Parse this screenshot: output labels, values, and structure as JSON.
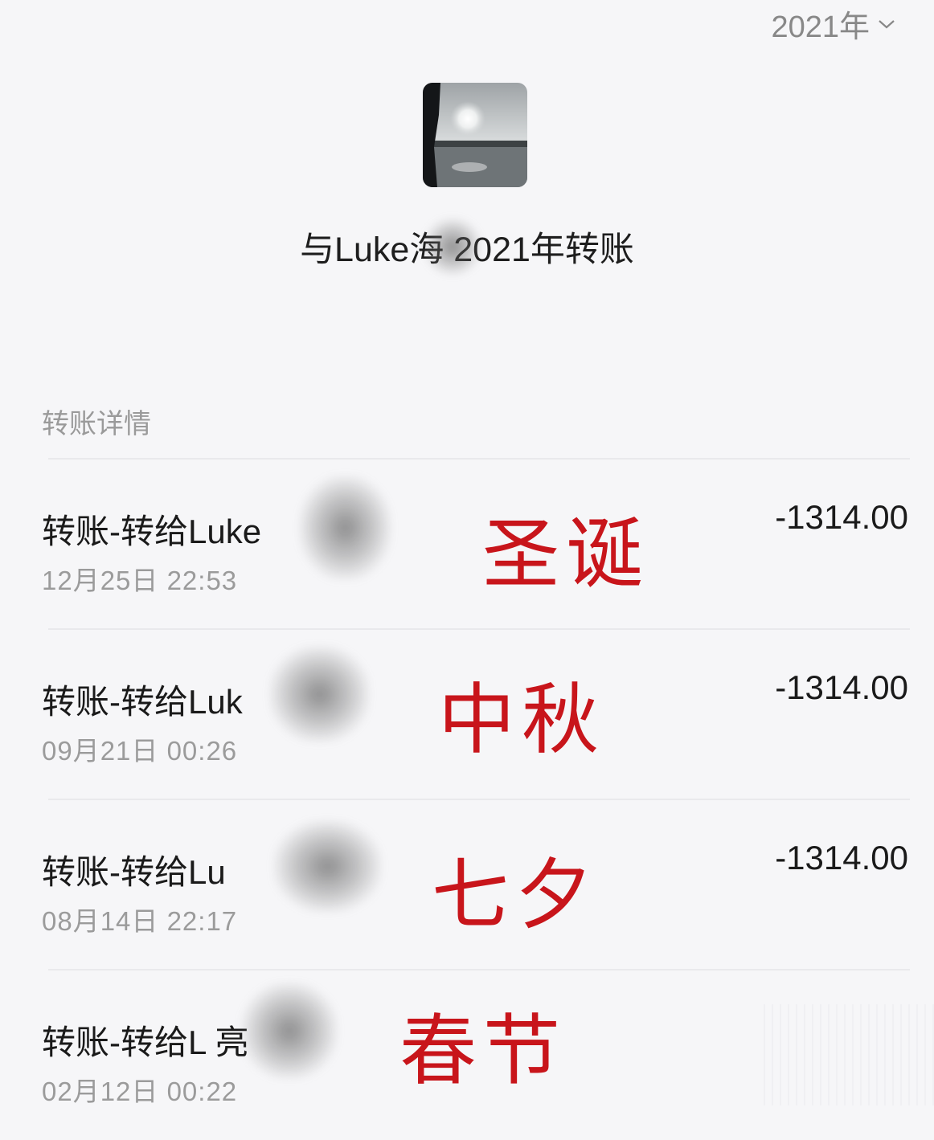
{
  "header": {
    "year_label": "2021年"
  },
  "page": {
    "title": "与Luke海 2021年转账"
  },
  "section": {
    "title": "转账详情"
  },
  "transactions": [
    {
      "title": "转账-转给Luke",
      "time": "12月25日 22:53",
      "amount": "-1314.00",
      "holiday": "圣诞"
    },
    {
      "title": "转账-转给Luk",
      "time": "09月21日 00:26",
      "amount": "-1314.00",
      "holiday": "中秋"
    },
    {
      "title": "转账-转给Lu",
      "time": "08月14日 22:17",
      "amount": "-1314.00",
      "holiday": "七夕"
    },
    {
      "title": "转账-转给L 亮",
      "time": "02月12日 00:22",
      "amount": "",
      "holiday": "春节"
    }
  ],
  "colors": {
    "background": "#f6f6f8",
    "holiday_red": "#c8151b",
    "muted_text": "#9b9b9b"
  },
  "icons": {
    "year_dropdown": "chevron-down-icon"
  }
}
